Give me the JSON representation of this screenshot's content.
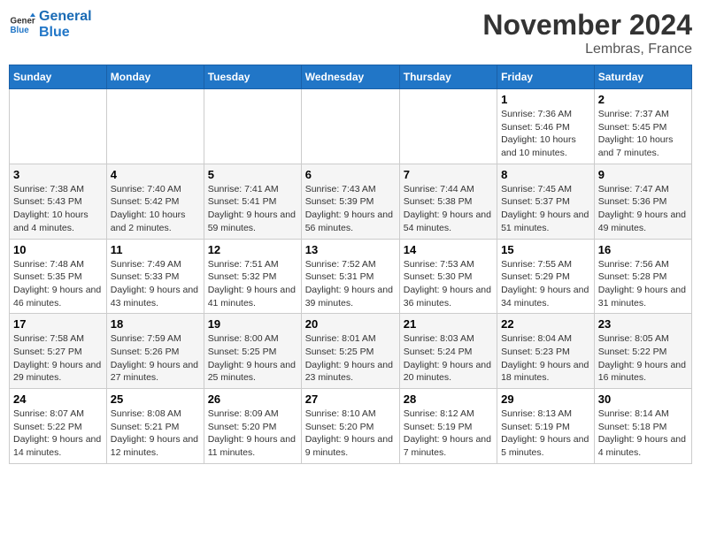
{
  "header": {
    "logo_line1": "General",
    "logo_line2": "Blue",
    "month": "November 2024",
    "location": "Lembras, France"
  },
  "weekdays": [
    "Sunday",
    "Monday",
    "Tuesday",
    "Wednesday",
    "Thursday",
    "Friday",
    "Saturday"
  ],
  "weeks": [
    [
      {
        "day": "",
        "info": ""
      },
      {
        "day": "",
        "info": ""
      },
      {
        "day": "",
        "info": ""
      },
      {
        "day": "",
        "info": ""
      },
      {
        "day": "",
        "info": ""
      },
      {
        "day": "1",
        "info": "Sunrise: 7:36 AM\nSunset: 5:46 PM\nDaylight: 10 hours and 10 minutes."
      },
      {
        "day": "2",
        "info": "Sunrise: 7:37 AM\nSunset: 5:45 PM\nDaylight: 10 hours and 7 minutes."
      }
    ],
    [
      {
        "day": "3",
        "info": "Sunrise: 7:38 AM\nSunset: 5:43 PM\nDaylight: 10 hours and 4 minutes."
      },
      {
        "day": "4",
        "info": "Sunrise: 7:40 AM\nSunset: 5:42 PM\nDaylight: 10 hours and 2 minutes."
      },
      {
        "day": "5",
        "info": "Sunrise: 7:41 AM\nSunset: 5:41 PM\nDaylight: 9 hours and 59 minutes."
      },
      {
        "day": "6",
        "info": "Sunrise: 7:43 AM\nSunset: 5:39 PM\nDaylight: 9 hours and 56 minutes."
      },
      {
        "day": "7",
        "info": "Sunrise: 7:44 AM\nSunset: 5:38 PM\nDaylight: 9 hours and 54 minutes."
      },
      {
        "day": "8",
        "info": "Sunrise: 7:45 AM\nSunset: 5:37 PM\nDaylight: 9 hours and 51 minutes."
      },
      {
        "day": "9",
        "info": "Sunrise: 7:47 AM\nSunset: 5:36 PM\nDaylight: 9 hours and 49 minutes."
      }
    ],
    [
      {
        "day": "10",
        "info": "Sunrise: 7:48 AM\nSunset: 5:35 PM\nDaylight: 9 hours and 46 minutes."
      },
      {
        "day": "11",
        "info": "Sunrise: 7:49 AM\nSunset: 5:33 PM\nDaylight: 9 hours and 43 minutes."
      },
      {
        "day": "12",
        "info": "Sunrise: 7:51 AM\nSunset: 5:32 PM\nDaylight: 9 hours and 41 minutes."
      },
      {
        "day": "13",
        "info": "Sunrise: 7:52 AM\nSunset: 5:31 PM\nDaylight: 9 hours and 39 minutes."
      },
      {
        "day": "14",
        "info": "Sunrise: 7:53 AM\nSunset: 5:30 PM\nDaylight: 9 hours and 36 minutes."
      },
      {
        "day": "15",
        "info": "Sunrise: 7:55 AM\nSunset: 5:29 PM\nDaylight: 9 hours and 34 minutes."
      },
      {
        "day": "16",
        "info": "Sunrise: 7:56 AM\nSunset: 5:28 PM\nDaylight: 9 hours and 31 minutes."
      }
    ],
    [
      {
        "day": "17",
        "info": "Sunrise: 7:58 AM\nSunset: 5:27 PM\nDaylight: 9 hours and 29 minutes."
      },
      {
        "day": "18",
        "info": "Sunrise: 7:59 AM\nSunset: 5:26 PM\nDaylight: 9 hours and 27 minutes."
      },
      {
        "day": "19",
        "info": "Sunrise: 8:00 AM\nSunset: 5:25 PM\nDaylight: 9 hours and 25 minutes."
      },
      {
        "day": "20",
        "info": "Sunrise: 8:01 AM\nSunset: 5:25 PM\nDaylight: 9 hours and 23 minutes."
      },
      {
        "day": "21",
        "info": "Sunrise: 8:03 AM\nSunset: 5:24 PM\nDaylight: 9 hours and 20 minutes."
      },
      {
        "day": "22",
        "info": "Sunrise: 8:04 AM\nSunset: 5:23 PM\nDaylight: 9 hours and 18 minutes."
      },
      {
        "day": "23",
        "info": "Sunrise: 8:05 AM\nSunset: 5:22 PM\nDaylight: 9 hours and 16 minutes."
      }
    ],
    [
      {
        "day": "24",
        "info": "Sunrise: 8:07 AM\nSunset: 5:22 PM\nDaylight: 9 hours and 14 minutes."
      },
      {
        "day": "25",
        "info": "Sunrise: 8:08 AM\nSunset: 5:21 PM\nDaylight: 9 hours and 12 minutes."
      },
      {
        "day": "26",
        "info": "Sunrise: 8:09 AM\nSunset: 5:20 PM\nDaylight: 9 hours and 11 minutes."
      },
      {
        "day": "27",
        "info": "Sunrise: 8:10 AM\nSunset: 5:20 PM\nDaylight: 9 hours and 9 minutes."
      },
      {
        "day": "28",
        "info": "Sunrise: 8:12 AM\nSunset: 5:19 PM\nDaylight: 9 hours and 7 minutes."
      },
      {
        "day": "29",
        "info": "Sunrise: 8:13 AM\nSunset: 5:19 PM\nDaylight: 9 hours and 5 minutes."
      },
      {
        "day": "30",
        "info": "Sunrise: 8:14 AM\nSunset: 5:18 PM\nDaylight: 9 hours and 4 minutes."
      }
    ]
  ]
}
